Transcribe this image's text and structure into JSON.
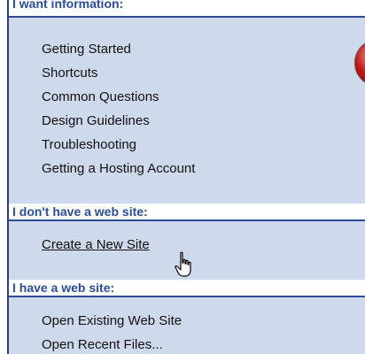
{
  "sections": [
    {
      "header": "I want information:",
      "items": [
        {
          "label": "Getting Started"
        },
        {
          "label": "Shortcuts"
        },
        {
          "label": "Common Questions"
        },
        {
          "label": "Design Guidelines"
        },
        {
          "label": "Troubleshooting"
        },
        {
          "label": "Getting a Hosting Account"
        }
      ]
    },
    {
      "header": "I don't have a web site:",
      "items": [
        {
          "label": "Create a New Site"
        }
      ]
    },
    {
      "header": "I have a web site:",
      "items": [
        {
          "label": "Open Existing Web Site"
        },
        {
          "label": "Open Recent Files..."
        }
      ]
    }
  ],
  "icons": {
    "cursor": "hand-pointer-icon",
    "orb": "red-orb-icon"
  },
  "colors": {
    "panel_background": "#cfd9ec",
    "header_text": "#2a4c9c",
    "header_rule": "#2c4c95",
    "item_text": "#111111"
  }
}
